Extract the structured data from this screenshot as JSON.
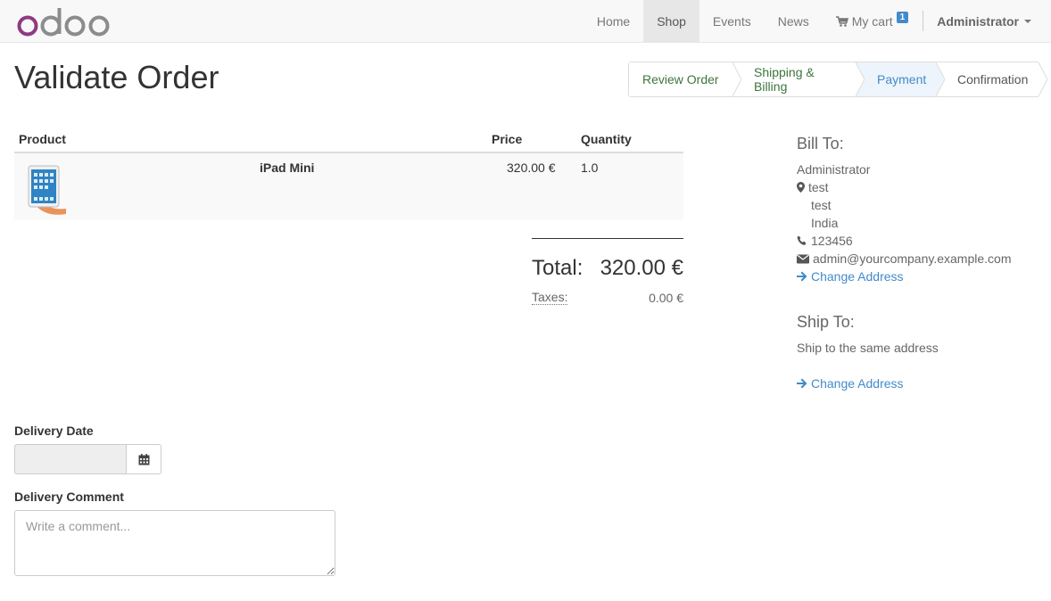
{
  "brand": {
    "name": "odoo",
    "color": "#875A7B"
  },
  "nav": {
    "items": [
      "Home",
      "Shop",
      "Events",
      "News"
    ],
    "active": "Shop",
    "cart_label": "My cart",
    "cart_count": "1",
    "user": "Administrator"
  },
  "page_title": "Validate Order",
  "wizard": {
    "steps": [
      "Review Order",
      "Shipping & Billing",
      "Payment",
      "Confirmation"
    ],
    "active": "Payment"
  },
  "table": {
    "headers": {
      "product": "Product",
      "price": "Price",
      "quantity": "Quantity"
    },
    "rows": [
      {
        "name": "iPad Mini",
        "price": "320.00 €",
        "quantity": "1.0"
      }
    ]
  },
  "totals": {
    "total_label": "Total:",
    "total_value": "320.00 €",
    "taxes_label": "Taxes:",
    "taxes_value": "0.00 €"
  },
  "bill_to": {
    "heading": "Bill To:",
    "name": "Administrator",
    "street": "test",
    "city": "test",
    "country": "India",
    "phone": "123456",
    "email": "admin@yourcompany.example.com",
    "change_link": "Change Address"
  },
  "ship_to": {
    "heading": "Ship To:",
    "text": "Ship to the same address",
    "change_link": "Change Address"
  },
  "delivery": {
    "date_label": "Delivery Date",
    "date_value": "",
    "comment_label": "Delivery Comment",
    "comment_placeholder": "Write a comment..."
  },
  "icons": {
    "cart": "shopping-cart-icon",
    "map_marker": "map-marker-icon",
    "phone": "phone-icon",
    "envelope": "envelope-icon",
    "arrow_right": "arrow-right-icon",
    "calendar": "calendar-icon"
  },
  "colors": {
    "link": "#428bca",
    "active_step_bg": "#eef4fb",
    "done_step": "#3c763d"
  }
}
